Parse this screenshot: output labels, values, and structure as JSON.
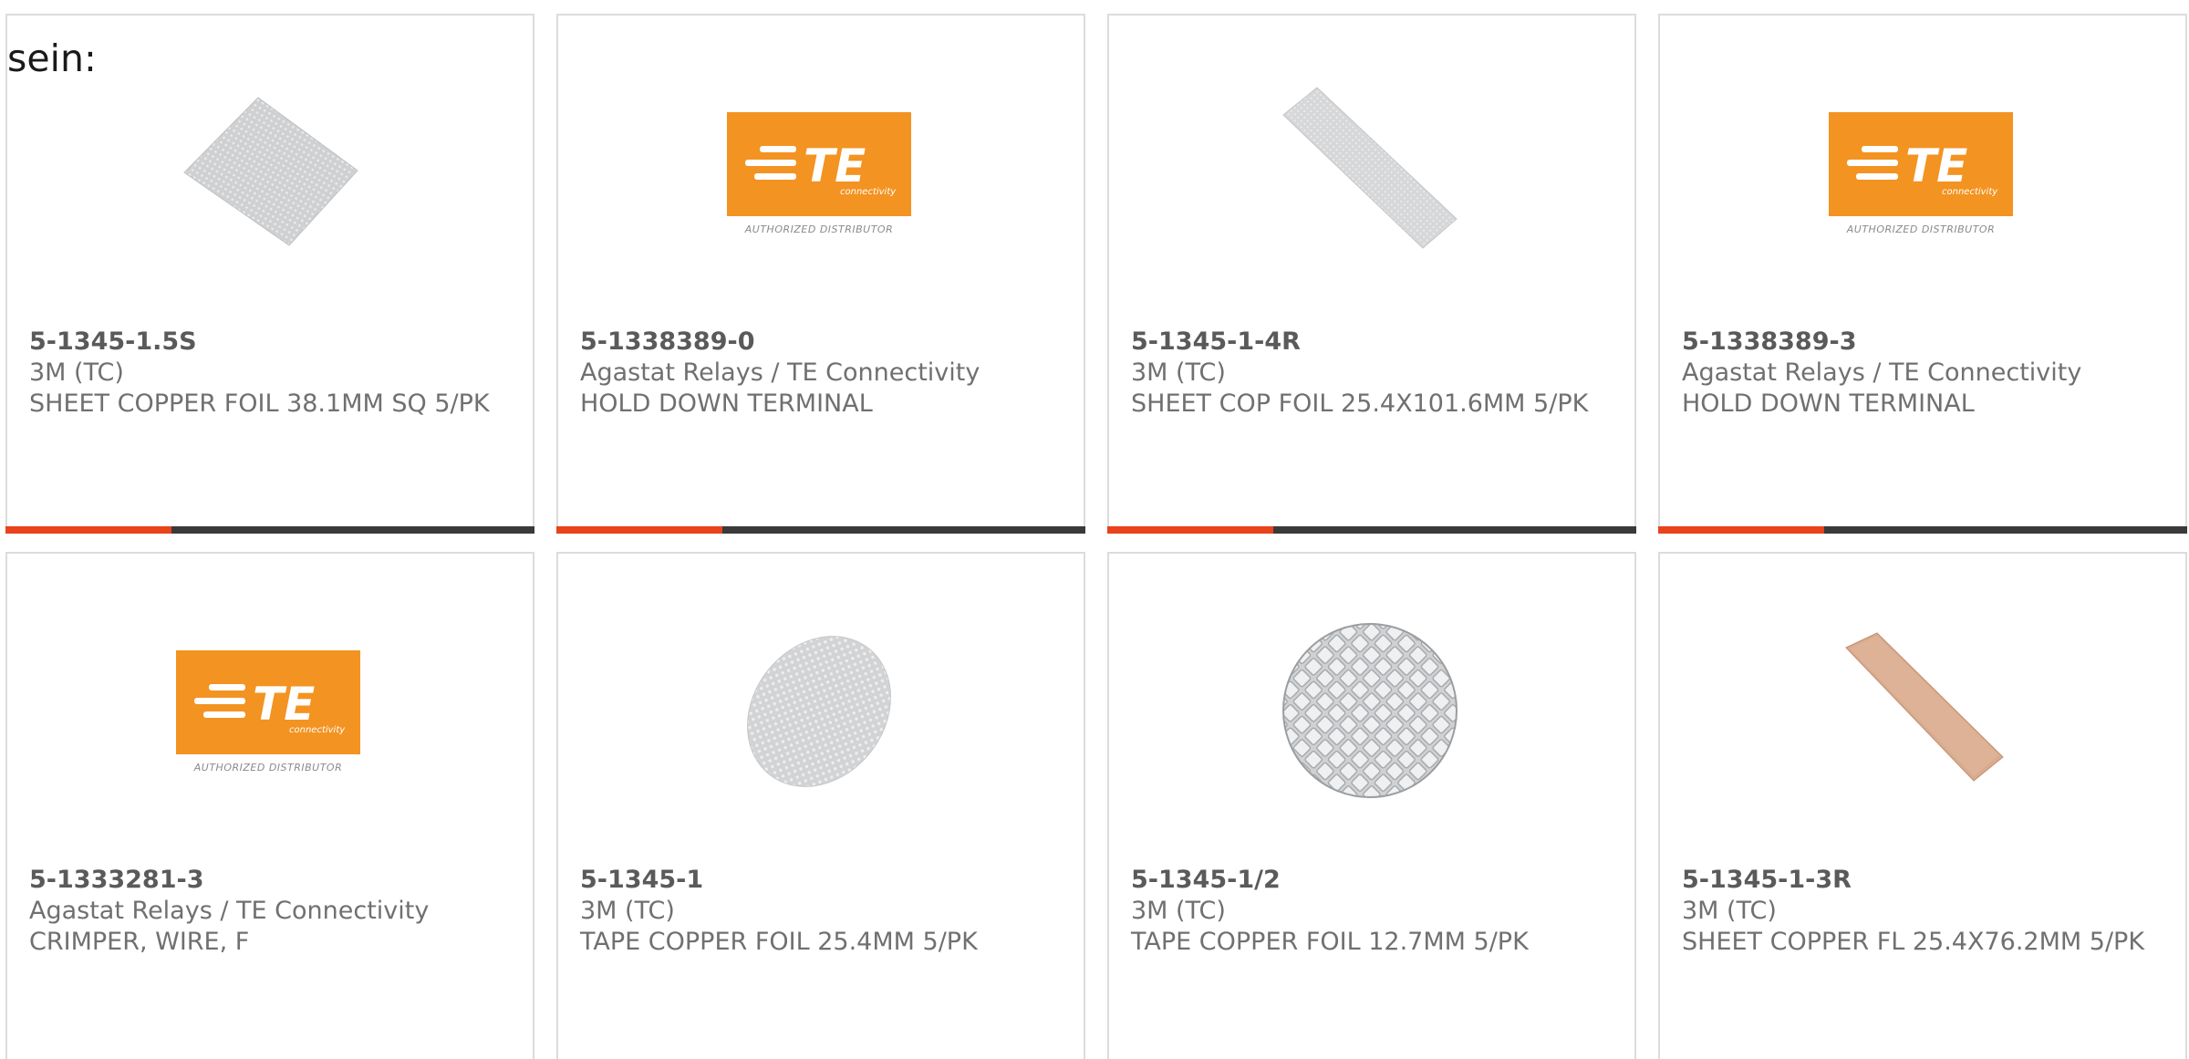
{
  "intro_text": "sein:",
  "colors": {
    "accent": "#e8431c",
    "bar": "#3a3a3a",
    "te_orange": "#f39321",
    "copper": "#d4a688"
  },
  "logo": {
    "brand": "TE",
    "sub": "connectivity",
    "tagline": "AUTHORIZED DISTRIBUTOR"
  },
  "products": [
    {
      "part_number": "5-1345-1.5S",
      "manufacturer": "3M (TC)",
      "description": "SHEET COPPER FOIL 38.1MM SQ 5/PK",
      "image": "square-foil-sheet"
    },
    {
      "part_number": "5-1338389-0",
      "manufacturer": "Agastat Relays / TE Connectivity",
      "description": "HOLD DOWN TERMINAL",
      "image": "te-connectivity-logo"
    },
    {
      "part_number": "5-1345-1-4R",
      "manufacturer": "3M (TC)",
      "description": "SHEET COP FOIL 25.4X101.6MM 5/PK",
      "image": "foil-strip"
    },
    {
      "part_number": "5-1338389-3",
      "manufacturer": "Agastat Relays / TE Connectivity",
      "description": "HOLD DOWN TERMINAL",
      "image": "te-connectivity-logo"
    },
    {
      "part_number": "5-1333281-3",
      "manufacturer": "Agastat Relays / TE Connectivity",
      "description": "CRIMPER, WIRE, F",
      "image": "te-connectivity-logo"
    },
    {
      "part_number": "5-1345-1",
      "manufacturer": "3M (TC)",
      "description": "TAPE COPPER FOIL 25.4MM 5/PK",
      "image": "round-foil-disc"
    },
    {
      "part_number": "5-1345-1/2",
      "manufacturer": "3M (TC)",
      "description": "TAPE COPPER FOIL 12.7MM 5/PK",
      "image": "round-embossed-disc"
    },
    {
      "part_number": "5-1345-1-3R",
      "manufacturer": "3M (TC)",
      "description": "SHEET COPPER FL 25.4X76.2MM 5/PK",
      "image": "copper-strip"
    }
  ]
}
